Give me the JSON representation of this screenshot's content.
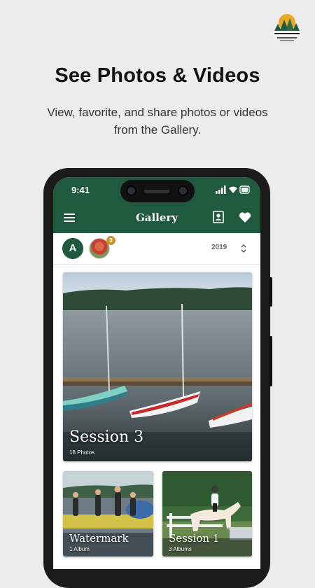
{
  "promo": {
    "headline": "See Photos & Videos",
    "subline": "View, favorite, and share photos or videos from the Gallery."
  },
  "status_bar": {
    "time": "9:41"
  },
  "app_bar": {
    "title": "Gallery",
    "menu_icon": "hamburger-menu-icon",
    "contact_icon": "contact-card-icon",
    "favorites_icon": "heart-icon"
  },
  "filter_bar": {
    "avatar_letter": "A",
    "photo_badge_count": "3",
    "year": "2019",
    "year_icon": "chevron-up-down-icon"
  },
  "albums": [
    {
      "title": "Session 3",
      "subtitle": "18 Photos"
    },
    {
      "title": "Watermark",
      "subtitle": "1 Album"
    },
    {
      "title": "Session 1",
      "subtitle": "3 Albums"
    }
  ],
  "colors": {
    "brand_green": "#1f5a3f",
    "badge_gold": "#c8962e",
    "background": "#ececec"
  }
}
